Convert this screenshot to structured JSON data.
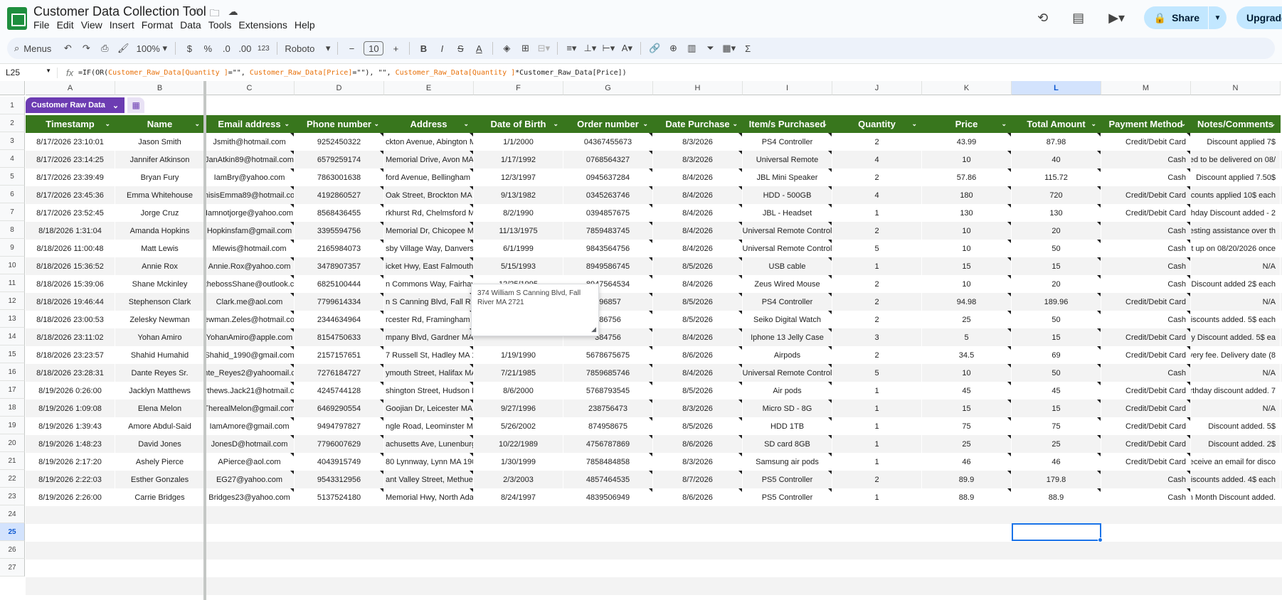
{
  "app": {
    "title": "Customer Data Collection Tool",
    "menu": [
      "File",
      "Edit",
      "View",
      "Insert",
      "Format",
      "Data",
      "Tools",
      "Extensions",
      "Help"
    ],
    "share_label": "Share",
    "upgrade_label": "Upgrade"
  },
  "toolbar": {
    "menus_label": "Menus",
    "zoom": "100%",
    "currency": "$",
    "percent": "%",
    "dec_decrease": ".0",
    "dec_increase": ".00",
    "number_format": "123",
    "font": "Roboto",
    "font_size": "10"
  },
  "formula_bar": {
    "cell_ref": "L25",
    "fx": "fx",
    "formula_parts": [
      {
        "t": "=IF(OR(",
        "ref": false
      },
      {
        "t": "Customer_Raw_Data[Quantity ]",
        "ref": true
      },
      {
        "t": "=\"\", ",
        "ref": false
      },
      {
        "t": "Customer_Raw_Data[Price]",
        "ref": true
      },
      {
        "t": "=\"\"), \"\", ",
        "ref": false
      },
      {
        "t": "Customer_Raw_Data[Quantity ]",
        "ref": true
      },
      {
        "t": "*Customer_Raw_Data[Price])",
        "ref": false
      }
    ]
  },
  "sheet": {
    "table_name": "Customer Raw Data",
    "columns": [
      "A",
      "B",
      "C",
      "D",
      "E",
      "F",
      "G",
      "H",
      "I",
      "J",
      "K",
      "L",
      "M",
      "N"
    ],
    "active_column": "L",
    "active_row": 25,
    "headers": [
      "Timestamp",
      "Name",
      "Email address",
      "Phone number",
      "Address",
      "Date of Birth",
      "Order number",
      "Date Purchase",
      "Item/s Purchased",
      "Quantity",
      "Price",
      "Total Amount",
      "Payment Method",
      "Notes/Comments"
    ],
    "rows": [
      [
        "8/17/2026 23:10:01",
        "Jason Smith",
        "Jsmith@hotmail.com",
        "9252450322",
        "ckton Avenue, Abington M",
        "1/1/2000",
        "04367455673",
        "8/3/2026",
        "PS4 Controller",
        "2",
        "43.99",
        "87.98",
        "Credit/Debit Card",
        "Discount applied 7$"
      ],
      [
        "8/17/2026 23:14:25",
        "Jannifer Atkinson",
        "JanAtkin89@hotmail.com",
        "6579259174",
        "Memorial Drive, Avon MA 2",
        "1/17/1992",
        "0768564327",
        "8/3/2026",
        "Universal Remote",
        "4",
        "10",
        "40",
        "Cash",
        "ed to be delivered on 08/"
      ],
      [
        "8/17/2026 23:39:49",
        "Bryan Fury",
        "IamBry@yahoo.com",
        "7863001638",
        "ford Avenue, Bellingham M",
        "12/3/1997",
        "0945637284",
        "8/4/2026",
        "JBL Mini Speaker",
        "2",
        "57.86",
        "115.72",
        "Cash",
        "Discount applied 7.50$"
      ],
      [
        "8/17/2026 23:45:36",
        "Emma Whitehouse",
        "hisisEmma89@hotmail.co",
        "4192860527",
        "Oak Street, Brockton MA 2",
        "9/13/1982",
        "0345263746",
        "8/4/2026",
        "HDD - 500GB",
        "4",
        "180",
        "720",
        "Credit/Debit Card",
        "Discounts applied 10$ each"
      ],
      [
        "8/17/2026 23:52:45",
        "Jorge Cruz",
        "Iamnotjorge@yahoo.com",
        "8568436455",
        "rkhurst Rd, Chelmsford M",
        "8/2/1990",
        "0394857675",
        "8/4/2026",
        "JBL - Headset",
        "1",
        "130",
        "130",
        "Credit/Debit Card",
        "irthday Discount added - 2"
      ],
      [
        "8/18/2026 1:31:04",
        "Amanda Hopkins",
        "Hopkinsfam@gmail.com",
        "3395594756",
        "Memorial Dr, Chicopee MA",
        "11/13/1975",
        "7859483745",
        "8/4/2026",
        "Universal Remote Control",
        "2",
        "10",
        "20",
        "Cash",
        "uesting assistance over th"
      ],
      [
        "8/18/2026 11:00:48",
        "Matt Lewis",
        "Mlewis@hotmail.com",
        "2165984073",
        "sby Village Way, Danvers",
        "6/1/1999",
        "9843564756",
        "8/4/2026",
        "Universal Remote Control",
        "5",
        "10",
        "50",
        "Cash",
        "et up on 08/20/2026 once"
      ],
      [
        "8/18/2026 15:36:52",
        "Annie Rox",
        "Annie.Rox@yahoo.com",
        "3478907357",
        "icket Hwy, East Falmouth",
        "5/15/1993",
        "8949586745",
        "8/5/2026",
        "USB cable",
        "1",
        "15",
        "15",
        "Cash",
        "N/A"
      ],
      [
        "8/18/2026 15:39:06",
        "Shane Mckinley",
        "thebossShane@outlook.c",
        "6825100444",
        "n Commons Way, Fairhav",
        "12/25/1995",
        "8947564534",
        "8/4/2026",
        "Zeus Wired Mouse",
        "2",
        "10",
        "20",
        "Cash",
        "Discount added 2$ each"
      ],
      [
        "8/18/2026 19:46:44",
        "Stephenson Clark",
        "Clark.me@aol.com",
        "7799614334",
        "n S Canning Blvd, Fall Rive",
        "",
        "596857",
        "8/5/2026",
        "PS4 Controller",
        "2",
        "94.98",
        "189.96",
        "Credit/Debit Card",
        "N/A"
      ],
      [
        "8/18/2026 23:00:53",
        "Zelesky Newman",
        "ewman.Zeles@hotmail.co",
        "2344634964",
        "rcester Rd, Framingham M",
        "",
        "586756",
        "8/5/2026",
        "Seiko Digital Watch",
        "2",
        "25",
        "50",
        "Cash",
        "Discounts added. 5$ each"
      ],
      [
        "8/18/2026 23:11:02",
        "Yohan Amiro",
        "YohanAmiro@apple.com",
        "8154750633",
        "mpany Blvd, Gardner MA",
        "",
        "384756",
        "8/4/2026",
        "Iphone 13 Jelly Case",
        "3",
        "5",
        "15",
        "Credit/Debit Card",
        "alty Discount added. 5$ ea"
      ],
      [
        "8/18/2026 23:23:57",
        "Shahid Humahid",
        "Shahid_1990@gmail.com",
        "2157157651",
        "7 Russell St, Hadley MA 10",
        "1/19/1990",
        "5678675675",
        "8/6/2026",
        "Airpods",
        "2",
        "34.5",
        "69",
        "Credit/Debit Card",
        "livery fee. Delivery date (8"
      ],
      [
        "8/18/2026 23:28:31",
        "Dante Reyes Sr.",
        "nte_Reyes2@yahoomail.c",
        "7276184727",
        "ymouth Street, Halifax MA",
        "7/21/1985",
        "7859685746",
        "8/4/2026",
        "Universal Remote Control",
        "5",
        "10",
        "50",
        "Cash",
        "N/A"
      ],
      [
        "8/19/2026 0:26:00",
        "Jacklyn Matthews",
        "rthews.Jack21@hotmail.c",
        "4245744128",
        "shington Street, Hudson M",
        "8/6/2000",
        "5768793545",
        "8/5/2026",
        "Air pods",
        "1",
        "45",
        "45",
        "Credit/Debit Card",
        "irthday discount added. 7"
      ],
      [
        "8/19/2026 1:09:08",
        "Elena Melon",
        "TherealMelon@gmail.com",
        "6469290554",
        "Goojian Dr, Leicester MA 1",
        "9/27/1996",
        "238756473",
        "8/3/2026",
        "Micro SD - 8G",
        "1",
        "15",
        "15",
        "Credit/Debit Card",
        "N/A"
      ],
      [
        "8/19/2026 1:39:43",
        "Amore Abdul-Said",
        "IamAmore@gmail.com",
        "9494797827",
        "ngle Road, Leominster MA",
        "5/26/2002",
        "874958675",
        "8/5/2026",
        "HDD 1TB",
        "1",
        "75",
        "75",
        "Credit/Debit Card",
        "Discount added. 5$"
      ],
      [
        "8/19/2026 1:48:23",
        "David Jones",
        "JonesD@hotmail.com",
        "7796007629",
        "achusetts Ave, Lunenburg",
        "10/22/1989",
        "4756787869",
        "8/6/2026",
        "SD card 8GB",
        "1",
        "25",
        "25",
        "Credit/Debit Card",
        "Discount added. 2$"
      ],
      [
        "8/19/2026 2:17:20",
        "Ashely Pierce",
        "APierce@aol.com",
        "4043915749",
        "80 Lynnway, Lynn MA 190",
        "1/30/1999",
        "7858484858",
        "8/3/2026",
        "Samsung air pods",
        "1",
        "46",
        "46",
        "Credit/Debit Card",
        "receive an email for disco"
      ],
      [
        "8/19/2026 2:22:03",
        "Esther Gonzales",
        "EG27@yahoo.com",
        "9543312956",
        "ant Valley Street, Methuen",
        "2/3/2003",
        "4857464535",
        "8/7/2026",
        "PS5 Controller",
        "2",
        "89.9",
        "179.8",
        "Cash",
        "Discounts added. 4$ each"
      ],
      [
        "8/19/2026 2:26:00",
        "Carrie Bridges",
        "Bridges23@yahoo.com",
        "5137524180",
        "Memorial Hwy, North Adan",
        "8/24/1997",
        "4839506949",
        "8/6/2026",
        "PS5 Controller",
        "1",
        "88.9",
        "88.9",
        "Cash",
        "th Month Discount added."
      ]
    ],
    "row_numbers": [
      "1",
      "2",
      "3",
      "4",
      "5",
      "6",
      "7",
      "8",
      "9",
      "10",
      "11",
      "12",
      "13",
      "14",
      "15",
      "16",
      "17",
      "18",
      "19",
      "20",
      "21",
      "22",
      "23",
      "24",
      "25",
      "26",
      "27"
    ]
  },
  "note": {
    "text": "374 William S Canning Blvd, Fall River MA 2721"
  }
}
